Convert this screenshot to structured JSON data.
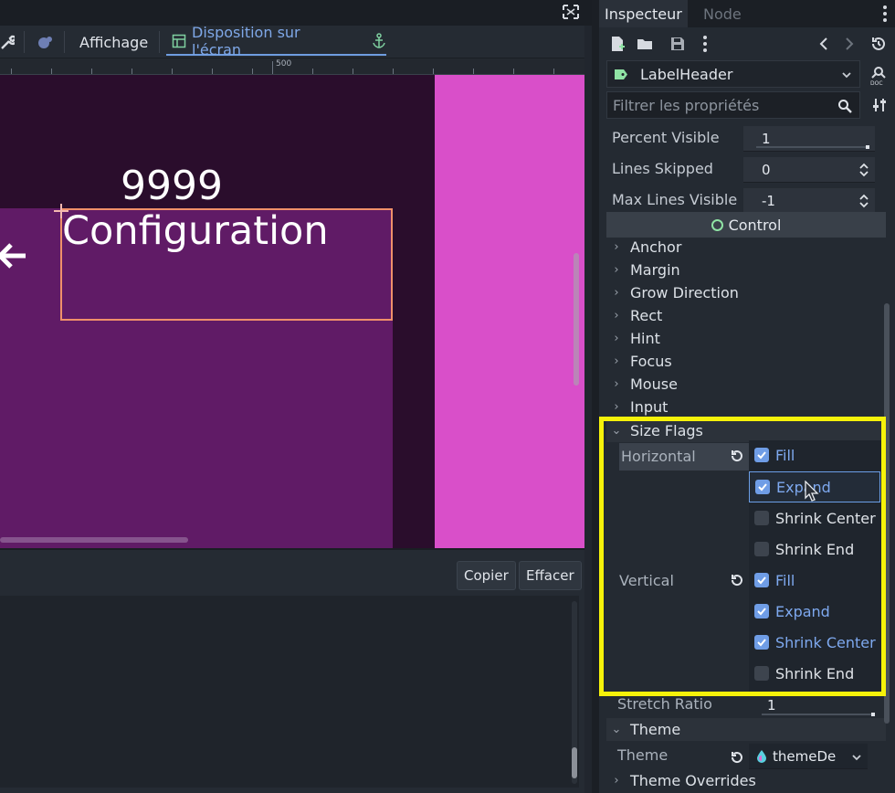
{
  "editor": {
    "toolbar": {
      "view_label": "Affichage",
      "layout_label": "Disposition sur l'écran"
    },
    "ruler_label": "500",
    "viewport": {
      "number_text": "9999",
      "title_text": "Configuration"
    },
    "output": {
      "copy_label": "Copier",
      "clear_label": "Effacer"
    }
  },
  "inspector": {
    "tabs": [
      "Inspecteur",
      "Node"
    ],
    "node_name": "LabelHeader",
    "filter_placeholder": "Filtrer les propriétés",
    "properties": [
      {
        "name": "Percent Visible",
        "value": "1"
      },
      {
        "name": "Lines Skipped",
        "value": "0"
      },
      {
        "name": "Max Lines Visible",
        "value": "-1"
      }
    ],
    "section_control": "Control",
    "groups": [
      "Anchor",
      "Margin",
      "Grow Direction",
      "Rect",
      "Hint",
      "Focus",
      "Mouse",
      "Input"
    ],
    "size_flags": {
      "title": "Size Flags",
      "horizontal_label": "Horizontal",
      "vertical_label": "Vertical",
      "horizontal": [
        {
          "label": "Fill",
          "checked": true
        },
        {
          "label": "Expand",
          "checked": true
        },
        {
          "label": "Shrink Center",
          "checked": false
        },
        {
          "label": "Shrink End",
          "checked": false
        }
      ],
      "vertical": [
        {
          "label": "Fill",
          "checked": true
        },
        {
          "label": "Expand",
          "checked": true
        },
        {
          "label": "Shrink Center",
          "checked": true
        },
        {
          "label": "Shrink End",
          "checked": false
        }
      ]
    },
    "stretch_ratio": {
      "name": "Stretch Ratio",
      "value": "1"
    },
    "theme_section": "Theme",
    "theme": {
      "name": "Theme",
      "value": "themeDe"
    },
    "theme_overrides": "Theme Overrides"
  },
  "colors": {
    "highlight": "#f6f20a",
    "checkbox_on": "#6f9de6",
    "selection": "#f0906a",
    "viewport_pink": "#d94fc9"
  }
}
